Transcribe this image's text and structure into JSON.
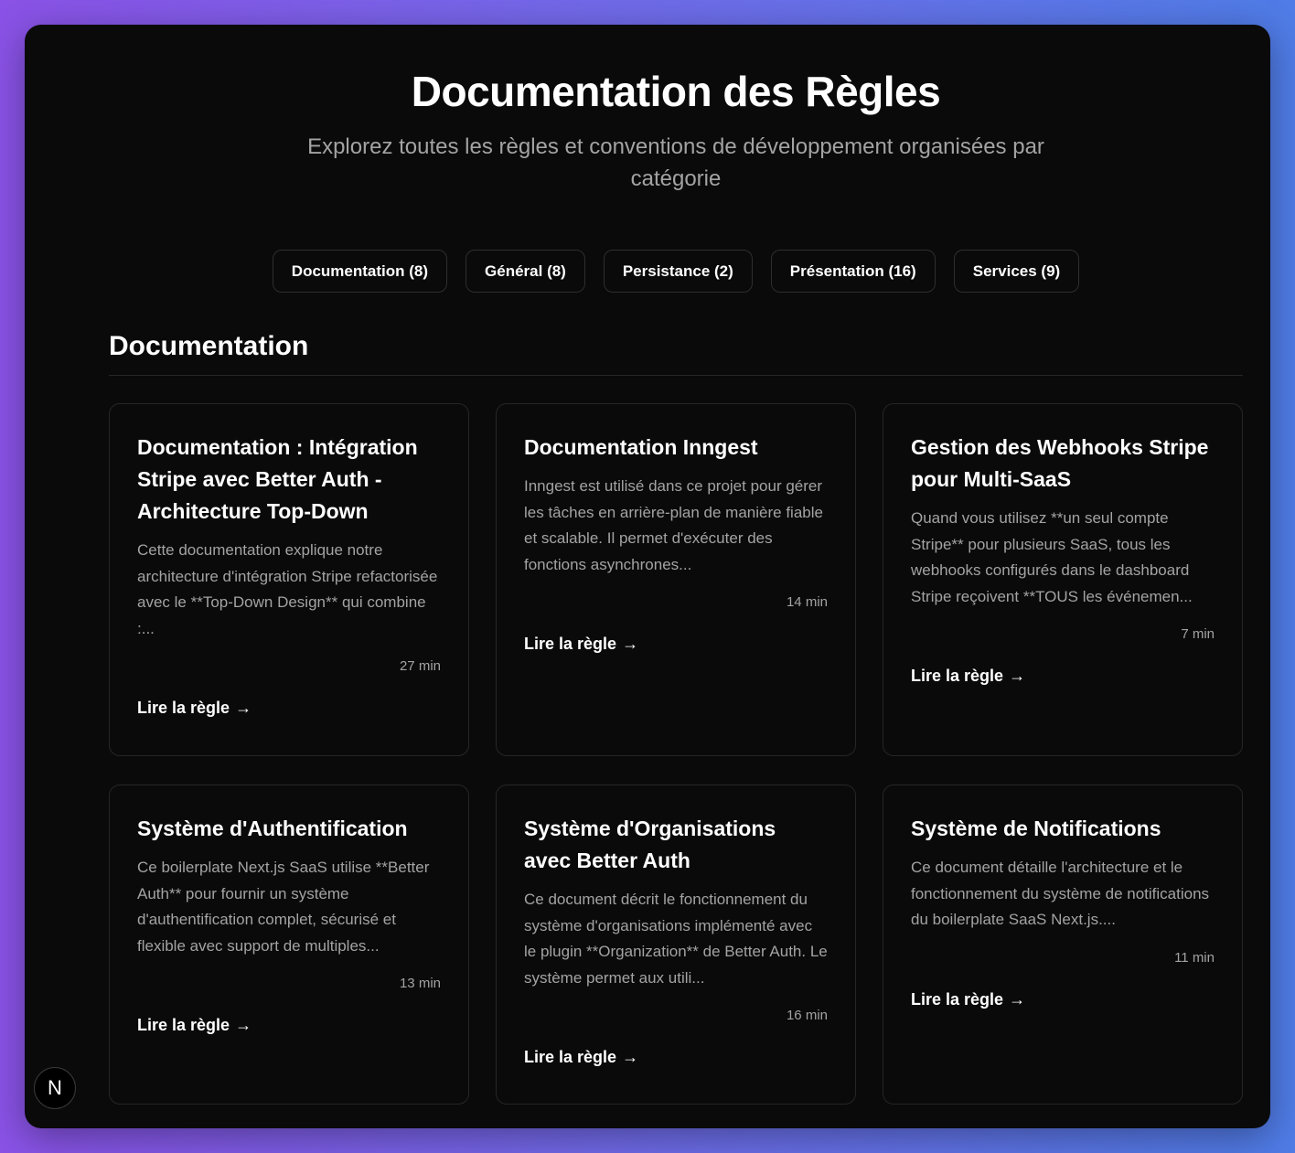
{
  "header": {
    "title": "Documentation des Règles",
    "subtitle": "Explorez toutes les règles et conventions de développement organisées par catégorie"
  },
  "filters": [
    {
      "label": "Documentation (8)"
    },
    {
      "label": "Général (8)"
    },
    {
      "label": "Persistance (2)"
    },
    {
      "label": "Présentation (16)"
    },
    {
      "label": "Services (9)"
    }
  ],
  "section": {
    "title": "Documentation"
  },
  "cards": [
    {
      "title": "Documentation : Intégration Stripe avec Better Auth - Architecture Top-Down",
      "description": "Cette documentation explique notre architecture d'intégration Stripe refactorisée avec le **Top-Down Design** qui combine :...",
      "time": "27 min",
      "link": "Lire la règle"
    },
    {
      "title": "Documentation Inngest",
      "description": "Inngest est utilisé dans ce projet pour gérer les tâches en arrière-plan de manière fiable et scalable. Il permet d'exécuter des fonctions asynchrones...",
      "time": "14 min",
      "link": "Lire la règle"
    },
    {
      "title": "Gestion des Webhooks Stripe pour Multi-SaaS",
      "description": "Quand vous utilisez **un seul compte Stripe** pour plusieurs SaaS, tous les webhooks configurés dans le dashboard Stripe reçoivent **TOUS les événemen...",
      "time": "7 min",
      "link": "Lire la règle"
    },
    {
      "title": "Système d'Authentification",
      "description": "Ce boilerplate Next.js SaaS utilise **Better Auth** pour fournir un système d'authentification complet, sécurisé et flexible avec support de multiples...",
      "time": "13 min",
      "link": "Lire la règle"
    },
    {
      "title": "Système d'Organisations avec Better Auth",
      "description": "Ce document décrit le fonctionnement du système d'organisations implémenté avec le plugin **Organization** de Better Auth. Le système permet aux utili...",
      "time": "16 min",
      "link": "Lire la règle"
    },
    {
      "title": "Système de Notifications",
      "description": "Ce document détaille l'architecture et le fonctionnement du système de notifications du boilerplate SaaS Next.js....",
      "time": "11 min",
      "link": "Lire la règle"
    }
  ],
  "icons": {
    "arrow": "→",
    "next_badge": "N"
  }
}
